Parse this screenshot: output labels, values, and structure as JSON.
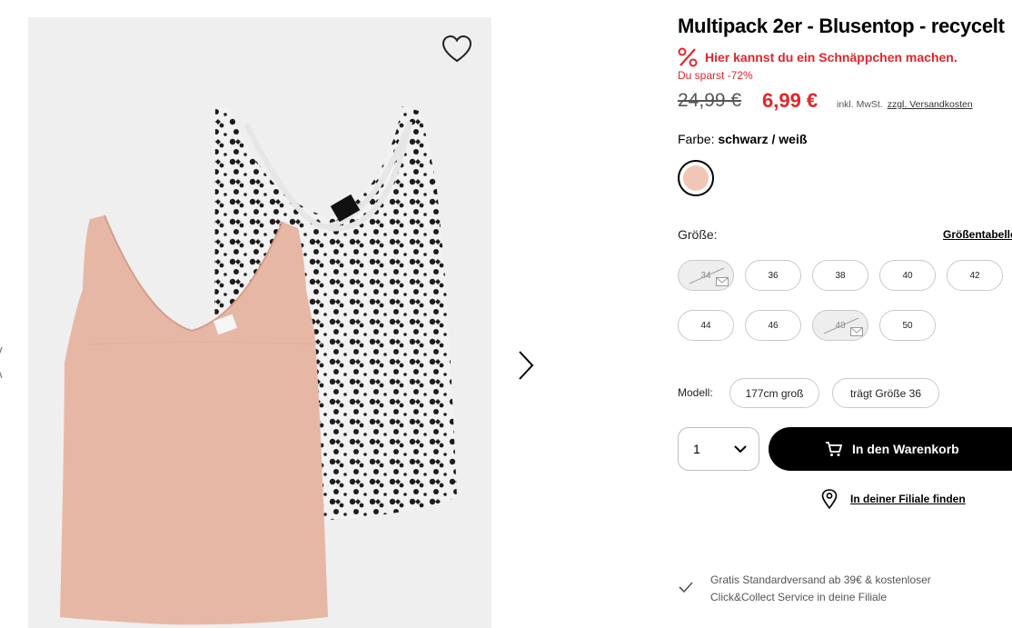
{
  "product": {
    "title": "Multipack 2er - Blusentop - recycelt",
    "deal_text": "Hier kannst du ein Schnäppchen machen.",
    "savings": "Du sparst -72%",
    "old_price": "24,99 €",
    "new_price": "6,99 €",
    "tax_text": "inkl. MwSt.",
    "shipping_link": "zzgl. Versandkosten"
  },
  "color": {
    "label": "Farbe:",
    "value": "schwarz / weiß",
    "swatch_color": "#f0c7b6"
  },
  "size": {
    "label": "Größe:",
    "table_link": "Größentabelle",
    "options": [
      {
        "label": "34",
        "available": false
      },
      {
        "label": "36",
        "available": true
      },
      {
        "label": "38",
        "available": true
      },
      {
        "label": "40",
        "available": true
      },
      {
        "label": "42",
        "available": true
      },
      {
        "label": "44",
        "available": true
      },
      {
        "label": "46",
        "available": true
      },
      {
        "label": "48",
        "available": false
      },
      {
        "label": "50",
        "available": true
      }
    ]
  },
  "model": {
    "label": "Modell:",
    "height": "177cm groß",
    "size": "trägt Größe 36"
  },
  "cart": {
    "quantity": "1",
    "button_label": "In den Warenkorb"
  },
  "store": {
    "link": "In deiner Filiale finden"
  },
  "info": {
    "line1": "Gratis Standardversand ab 39€ & kostenloser",
    "line2": "Click&Collect Service in deine Filiale"
  },
  "colors": {
    "sale_red": "#e4242a",
    "black": "#000000",
    "image_bg": "#efefef"
  }
}
